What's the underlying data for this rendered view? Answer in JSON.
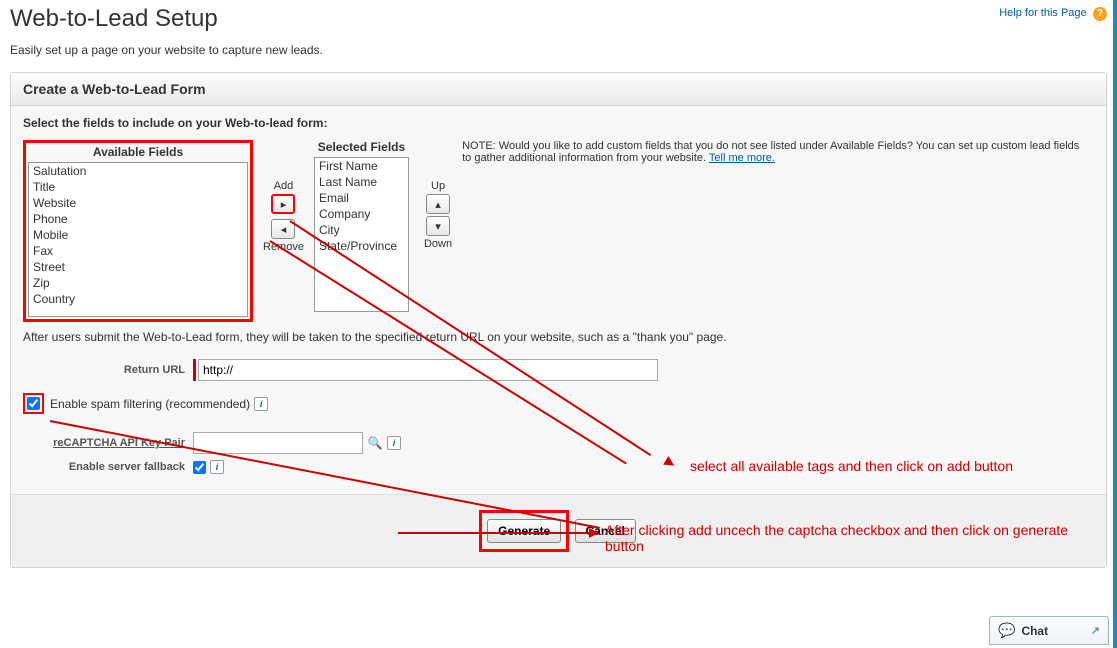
{
  "header": {
    "title": "Web-to-Lead Setup",
    "help_link": "Help for this Page"
  },
  "description": "Easily set up a page on your website to capture new leads.",
  "panel": {
    "heading": "Create a Web-to-Lead Form",
    "instruction": "Select the fields to include on your Web-to-lead form:",
    "available_label": "Available Fields",
    "selected_label": "Selected Fields",
    "available_fields": [
      "Salutation",
      "Title",
      "Website",
      "Phone",
      "Mobile",
      "Fax",
      "Street",
      "Zip",
      "Country"
    ],
    "selected_fields": [
      "First Name",
      "Last Name",
      "Email",
      "Company",
      "City",
      "State/Province"
    ],
    "add_label": "Add",
    "remove_label": "Remove",
    "up_label": "Up",
    "down_label": "Down",
    "note": "NOTE: Would you like to add custom fields that you do not see listed under Available Fields? You can set up custom lead fields to gather additional information from your website. ",
    "note_link": "Tell me more.",
    "after_submit": "After users submit the Web-to-Lead form, they will be taken to the specified return URL on your website, such as a \"thank you\" page.",
    "return_url_label": "Return URL",
    "return_url_value": "http://",
    "spam_label": "Enable spam filtering (recommended)",
    "recaptcha_label": "reCAPTCHA API Key Pair",
    "fallback_label": "Enable server fallback",
    "generate_btn": "Generate",
    "cancel_btn": "Cancel"
  },
  "annotations": {
    "top": "select all available tags and then click on add button",
    "bottom": "After clicking add uncech the captcha checkbox and then click on generate button"
  },
  "chat": {
    "label": "Chat"
  }
}
